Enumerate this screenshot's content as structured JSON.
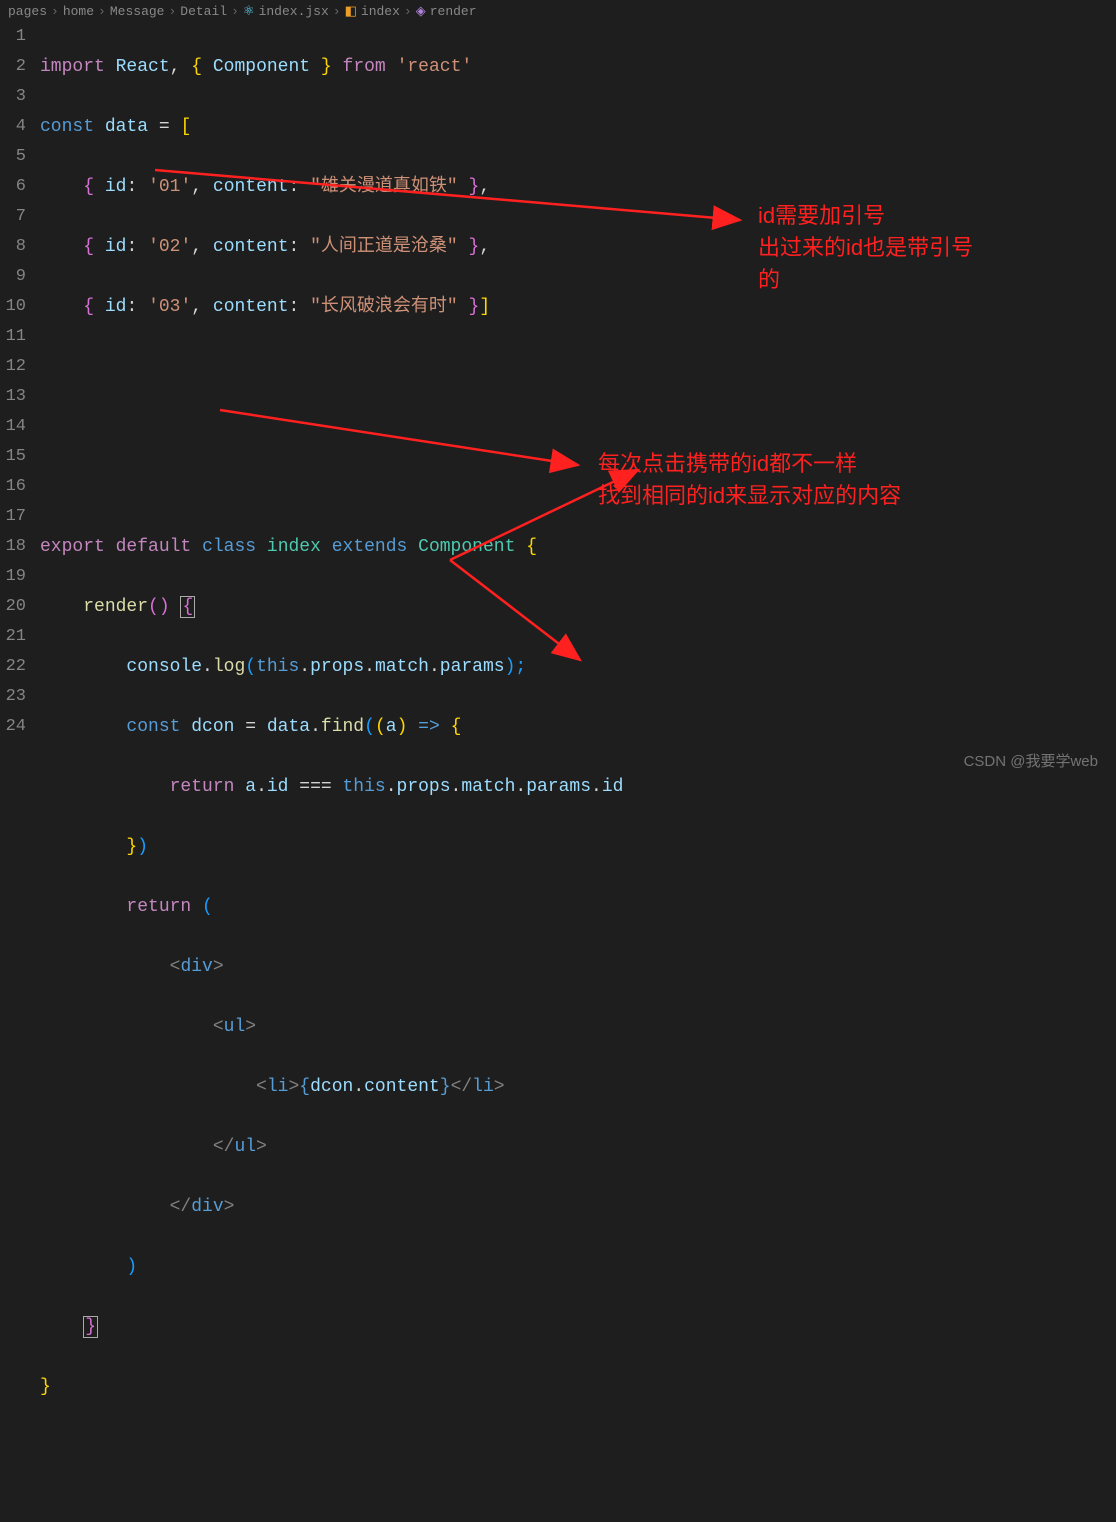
{
  "breadcrumb": {
    "items": [
      "pages",
      "home",
      "Message",
      "Detail",
      "index.jsx",
      "index",
      "render"
    ]
  },
  "lineNumbers": [
    "1",
    "2",
    "3",
    "4",
    "5",
    "6",
    "7",
    "8",
    "9",
    "10",
    "11",
    "12",
    "13",
    "14",
    "15",
    "16",
    "17",
    "18",
    "19",
    "20",
    "21",
    "22",
    "23",
    "24"
  ],
  "code": {
    "l1": {
      "import": "import",
      "react": "React",
      "comma": ", ",
      "lb": "{",
      "component": "Component",
      "rb": "}",
      "from": "from",
      "str": "'react'"
    },
    "l2": {
      "const": "const",
      "data": "data",
      "eq": " = ",
      "lb": "["
    },
    "l3": {
      "lb": "{",
      "id": "id",
      "c1": ": ",
      "v1": "'01'",
      "cm": ", ",
      "content": "content",
      "c2": ": ",
      "v2": "\"雄关漫道真如铁\"",
      "rb": "}",
      "end": ","
    },
    "l4": {
      "lb": "{",
      "id": "id",
      "c1": ": ",
      "v1": "'02'",
      "cm": ", ",
      "content": "content",
      "c2": ": ",
      "v2": "\"人间正道是沧桑\"",
      "rb": "}",
      "end": ","
    },
    "l5": {
      "lb": "{",
      "id": "id",
      "c1": ": ",
      "v1": "'03'",
      "cm": ", ",
      "content": "content",
      "c2": ": ",
      "v2": "\"长风破浪会有时\"",
      "rb": "}",
      "end": "]"
    },
    "l9": {
      "export": "export",
      "default": "default",
      "class": "class",
      "name": "index",
      "extends": "extends",
      "comp": "Component",
      "lb": "{"
    },
    "l10": {
      "render": "render",
      "p": "()",
      "lb": "{"
    },
    "l11": {
      "console": "console",
      "dot": ".",
      "log": "log",
      "lp": "(",
      "this": "this",
      "d1": ".",
      "props": "props",
      "d2": ".",
      "match": "match",
      "d3": ".",
      "params": "params",
      "rp": ");"
    },
    "l12": {
      "const": "const",
      "dcon": "dcon",
      "eq": " = ",
      "data": "data",
      "dot": ".",
      "find": "find",
      "lp": "(",
      "lp2": "(",
      "a": "a",
      "rp2": ")",
      "arrow": " => ",
      "lb": "{"
    },
    "l13": {
      "return": "return",
      "a": "a",
      "d1": ".",
      "id": "id",
      "eqeq": " === ",
      "this": "this",
      "d2": ".",
      "props": "props",
      "d3": ".",
      "match": "match",
      "d4": ".",
      "params": "params",
      "d5": ".",
      "id2": "id"
    },
    "l14": {
      "rb": "}",
      "rp": ")"
    },
    "l15": {
      "return": "return",
      "lp": "("
    },
    "l16": {
      "o": "<",
      "tag": "div",
      "c": ">"
    },
    "l17": {
      "o": "<",
      "tag": "ul",
      "c": ">"
    },
    "l18": {
      "o": "<",
      "tag": "li",
      "c": ">",
      "lb": "{",
      "dcon": "dcon",
      "dot": ".",
      "content": "content",
      "rb": "}",
      "co": "</",
      "tag2": "li",
      "cc": ">"
    },
    "l19": {
      "co": "</",
      "tag": "ul",
      "cc": ">"
    },
    "l20": {
      "co": "</",
      "tag": "div",
      "cc": ">"
    },
    "l21": {
      "rp": ")"
    },
    "l22": {
      "rb": "}"
    },
    "l23": {
      "rb": "}"
    }
  },
  "annotations": {
    "a1_line1": "id需要加引号",
    "a1_line2": "出过来的id也是带引号",
    "a1_line3": "的",
    "a2_line1": "每次点击携带的id都不一样",
    "a2_line2": "找到相同的id来显示对应的内容"
  },
  "watermark": "CSDN @我要学web"
}
